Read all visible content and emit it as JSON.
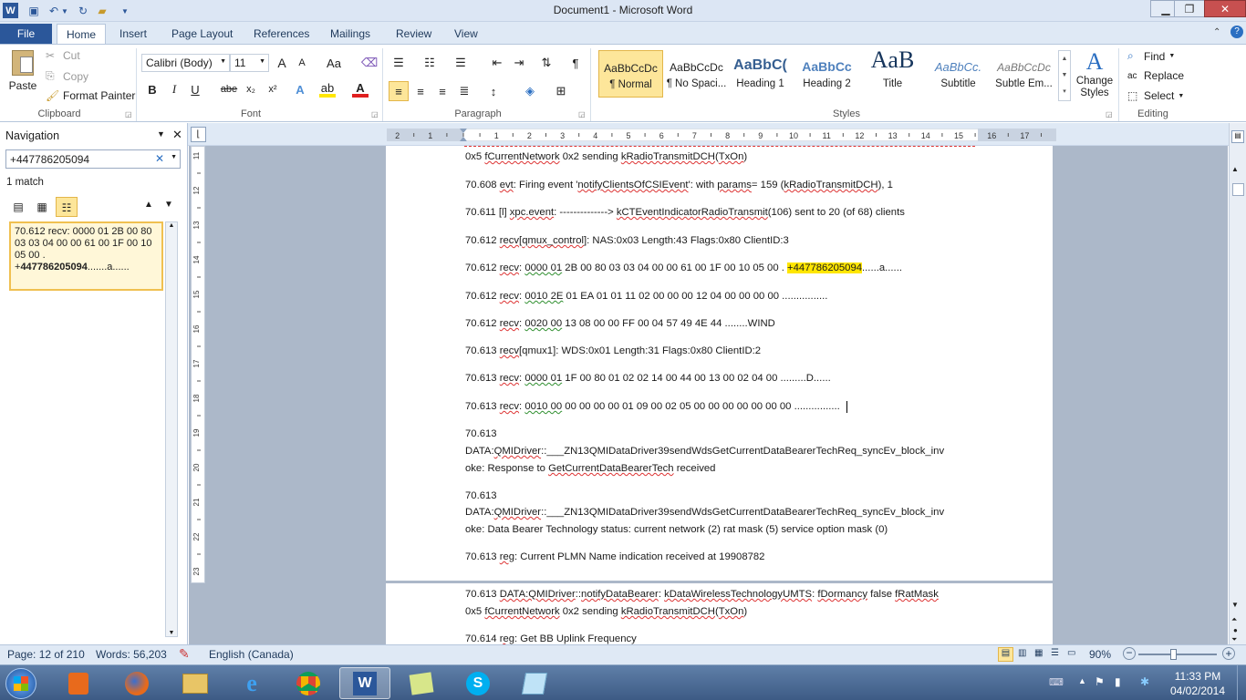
{
  "window": {
    "title": "Document1  -  Microsoft Word",
    "app_icon": "W",
    "buttons": {
      "minimize": "▁",
      "maximize": "❐",
      "close": "✕"
    }
  },
  "tabs": [
    "File",
    "Home",
    "Insert",
    "Page Layout",
    "References",
    "Mailings",
    "Review",
    "View"
  ],
  "ribbon": {
    "clipboard": {
      "paste": "Paste",
      "cut": "Cut",
      "copy": "Copy",
      "format_painter": "Format Painter",
      "label": "Clipboard"
    },
    "font": {
      "name": "Calibri (Body)",
      "size": "11",
      "label": "Font",
      "bold": "B",
      "italic": "I",
      "underline": "U",
      "strike": "abe",
      "sub": "x₂",
      "sup": "x²",
      "grow": "A",
      "shrink": "A",
      "case": "Aa"
    },
    "paragraph": {
      "label": "Paragraph",
      "pilcrow": "¶"
    },
    "styles": {
      "label": "Styles",
      "items": [
        {
          "sample": "AaBbCcDc",
          "name": "¶ Normal"
        },
        {
          "sample": "AaBbCcDc",
          "name": "¶ No Spaci..."
        },
        {
          "sample": "AaBbC(",
          "name": "Heading 1"
        },
        {
          "sample": "AaBbCc",
          "name": "Heading 2"
        },
        {
          "sample": "AaB",
          "name": "Title"
        },
        {
          "sample": "AaBbCc.",
          "name": "Subtitle"
        },
        {
          "sample": "AaBbCcDc",
          "name": "Subtle Em..."
        }
      ],
      "change_styles": "Change Styles"
    },
    "editing": {
      "label": "Editing",
      "find": "Find",
      "replace": "Replace",
      "select": "Select"
    }
  },
  "nav": {
    "title": "Navigation",
    "search_value": "+447786205094",
    "matches": "1 match",
    "result_text": "70.612 recv: 0000  01 2B 00 80 03 03 04 00 00 61 00 1F 00 10 05 00    . +",
    "result_bold": "447786205094",
    "result_tail": ".......a......"
  },
  "document": {
    "top_lines": [
      {
        "parts": [
          [
            "0x5 ",
            ""
          ],
          [
            "fCurrentNetwork",
            "u"
          ],
          [
            " 0x2 sending ",
            ""
          ],
          [
            "kRadioTransmitDCH",
            "u"
          ],
          [
            "(",
            ""
          ],
          [
            "TxOn",
            "u"
          ],
          [
            ")",
            ""
          ]
        ]
      },
      {
        "parts": [
          [
            "70.608 ",
            ""
          ],
          [
            "evt",
            "u"
          ],
          [
            ": Firing event '",
            ""
          ],
          [
            "notifyClientsOfCSIEvent",
            "u"
          ],
          [
            "': with ",
            ""
          ],
          [
            "params",
            "u"
          ],
          [
            "= 159 (",
            ""
          ],
          [
            "kRadioTransmitDCH",
            "u"
          ],
          [
            "), 1",
            ""
          ]
        ]
      },
      {
        "parts": [
          [
            "70.611 [l] ",
            ""
          ],
          [
            "xpc.event",
            "u"
          ],
          [
            ":   --------------> ",
            ""
          ],
          [
            "kCTEventIndicatorRadioTransmit",
            "u"
          ],
          [
            "(106) sent to 20 (of 68) clients",
            ""
          ]
        ]
      },
      {
        "parts": [
          [
            "70.612 ",
            ""
          ],
          [
            "recv",
            "u"
          ],
          [
            "[",
            ""
          ],
          [
            "qmux_control",
            "u"
          ],
          [
            "]: NAS:0x03 Length:43 Flags:0x80 ClientID:3",
            ""
          ]
        ]
      },
      {
        "parts": [
          [
            "70.612 ",
            ""
          ],
          [
            "recv",
            "u"
          ],
          [
            ": ",
            ""
          ],
          [
            "0000  01",
            "ug"
          ],
          [
            " 2B 00 80 03 03 04 00 00 61 00 1F 00 10 05 00    . ",
            ""
          ],
          [
            "+447786205094",
            "hl"
          ],
          [
            "......a......",
            ""
          ]
        ]
      },
      {
        "parts": [
          [
            "70.612 ",
            ""
          ],
          [
            "recv",
            "u"
          ],
          [
            ": ",
            ""
          ],
          [
            "0010  2E",
            "ug"
          ],
          [
            " 01 EA 01 01 11 02 00 00 00 12 04 00 00 00 00    ................",
            ""
          ]
        ]
      },
      {
        "parts": [
          [
            "70.612 ",
            ""
          ],
          [
            "recv",
            "u"
          ],
          [
            ": ",
            ""
          ],
          [
            "0020  00",
            "ug"
          ],
          [
            " 13 08 00 00 FF 00 04 57 49 4E 44                ........WIND",
            ""
          ]
        ]
      },
      {
        "parts": [
          [
            "70.613 ",
            ""
          ],
          [
            "recv",
            "u"
          ],
          [
            "[qmux1]: WDS:0x01 Length:31 Flags:0x80 ClientID:2",
            ""
          ]
        ]
      },
      {
        "parts": [
          [
            "70.613 ",
            ""
          ],
          [
            "recv",
            "u"
          ],
          [
            ": ",
            ""
          ],
          [
            "0000  01",
            "ug"
          ],
          [
            " 1F 00 80 01 02 02 14 00 44 00 13 00 02 04 00    .........D......",
            ""
          ]
        ]
      },
      {
        "parts": [
          [
            "70.613 ",
            ""
          ],
          [
            "recv",
            "u"
          ],
          [
            ": ",
            ""
          ],
          [
            "0010  00",
            "ug"
          ],
          [
            " 00 00 00 00 01 09 00 02 05 00 00 00 00 00 00 00    ................",
            ""
          ]
        ]
      },
      {
        "parts": [
          [
            "70.613",
            ""
          ]
        ]
      },
      {
        "parts": [
          [
            "DATA:",
            ""
          ],
          [
            "QMIDriver",
            "u"
          ],
          [
            "::___ZN13QMIDataDriver39sendWdsGetCurrentDataBearerTechReq_syncEv_block_inv",
            ""
          ]
        ]
      },
      {
        "parts": [
          [
            "oke: Response to ",
            ""
          ],
          [
            "GetCurrentDataBearerTech",
            "u"
          ],
          [
            " received",
            ""
          ]
        ]
      },
      {
        "parts": [
          [
            "70.613",
            ""
          ]
        ]
      },
      {
        "parts": [
          [
            "DATA:",
            ""
          ],
          [
            "QMIDriver",
            "u"
          ],
          [
            "::___ZN13QMIDataDriver39sendWdsGetCurrentDataBearerTechReq_syncEv_block_inv",
            ""
          ]
        ]
      },
      {
        "parts": [
          [
            "oke: Data Bearer Technology status:  current network (2) rat mask (5) service option mask (0)",
            ""
          ]
        ]
      },
      {
        "parts": [
          [
            "70.613 ",
            ""
          ],
          [
            "reg",
            "u"
          ],
          [
            ": Current PLMN Name indication received at 19908782",
            ""
          ]
        ]
      }
    ],
    "bottom_lines": [
      {
        "parts": [
          [
            "70.613 ",
            ""
          ],
          [
            "DATA:QMIDriver",
            "u"
          ],
          [
            "::",
            ""
          ],
          [
            "notifyDataBearer",
            "u"
          ],
          [
            ": ",
            ""
          ],
          [
            "kDataWirelessTechnologyUMTS",
            "u"
          ],
          [
            ": ",
            ""
          ],
          [
            "fDormancy",
            "u"
          ],
          [
            " false ",
            ""
          ],
          [
            "fRatMask",
            "u"
          ]
        ]
      },
      {
        "parts": [
          [
            "0x5 ",
            ""
          ],
          [
            "fCurrentNetwork",
            "u"
          ],
          [
            " 0x2 sending ",
            ""
          ],
          [
            "kRadioTransmitDCH",
            "u"
          ],
          [
            "(",
            ""
          ],
          [
            "TxOn",
            "u"
          ],
          [
            ")",
            ""
          ]
        ]
      },
      {
        "parts": [
          [
            "70.614 ",
            ""
          ],
          [
            "reg",
            "u"
          ],
          [
            ": Get BB Uplink Frequency",
            ""
          ]
        ]
      }
    ]
  },
  "status": {
    "page": "Page: 12 of 210",
    "words": "Words: 56,203",
    "language": "English (Canada)",
    "zoom": "90%",
    "zoom_level": 0.9
  },
  "taskbar": {
    "time": "11:33 PM",
    "date": "04/02/2014"
  },
  "colors": {
    "accent": "#2b579a",
    "highlight": "#ffe600"
  }
}
